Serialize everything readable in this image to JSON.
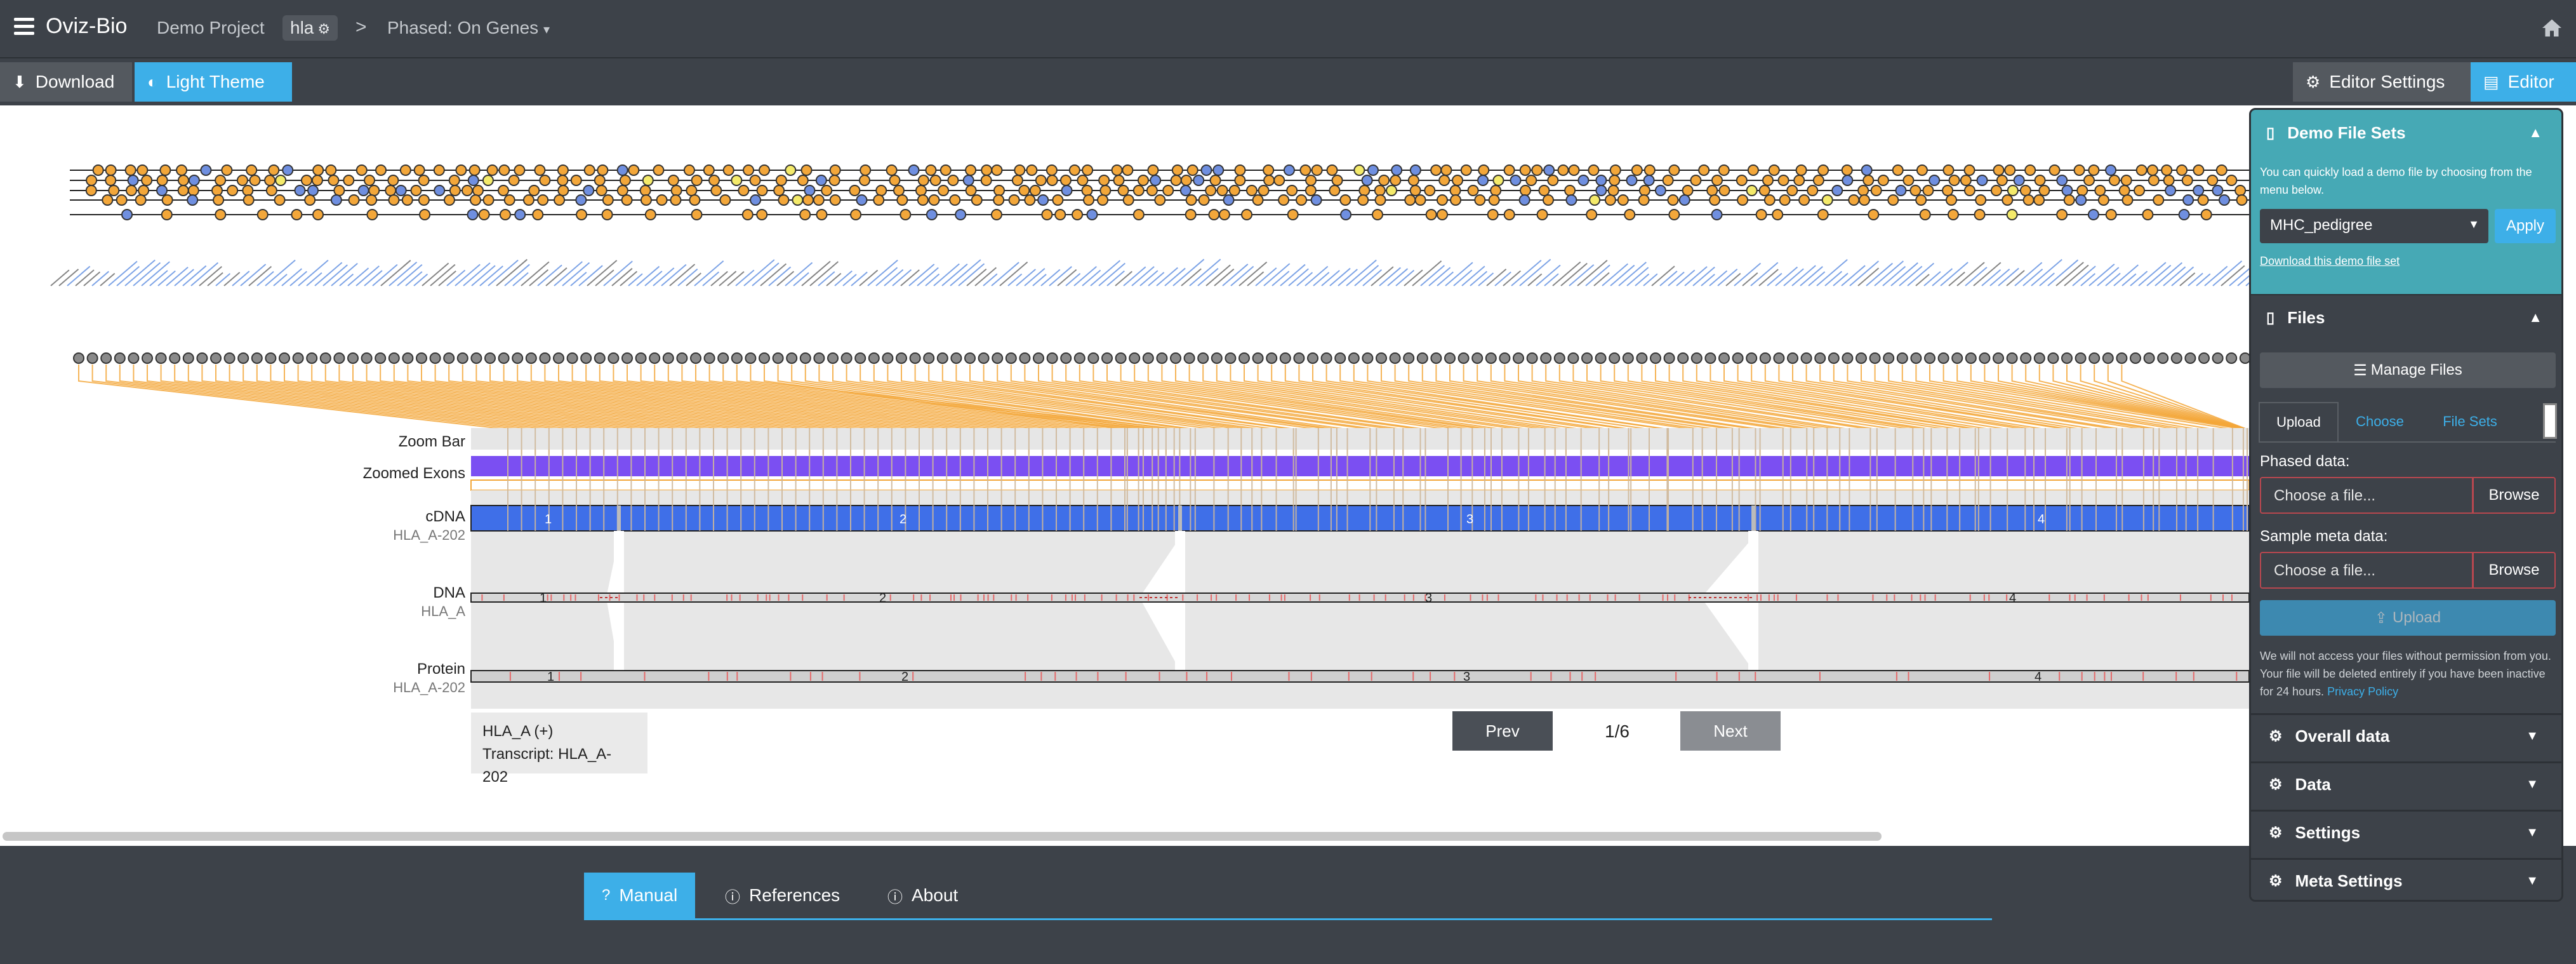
{
  "navbar": {
    "brand": "Oviz-Bio",
    "project": "Demo Project",
    "badge": "hla",
    "separator": ">",
    "phase": "Phased: On Genes",
    "icons": [
      "menu-icon",
      "gear-icon",
      "chevron-right-icon",
      "caret-down-icon",
      "home-icon"
    ]
  },
  "toolbar": {
    "download_label": "Download",
    "theme_label": "Light Theme",
    "editor_settings_label": "Editor Settings",
    "editor_label": "Editor"
  },
  "track_labels": {
    "zoom_bar": "Zoom Bar",
    "zoomed_exons": "Zoomed Exons",
    "cdna": "cDNA",
    "cdna_sub": "HLA_A-202",
    "dna": "DNA",
    "dna_sub": "HLA_A",
    "protein": "Protein",
    "protein_sub": "HLA_A-202"
  },
  "exon_numbers": [
    "1",
    "2",
    "3",
    "4"
  ],
  "info_box": {
    "gene": "HLA_A (+)",
    "transcript": "Transcript: HLA_A-202"
  },
  "pager": {
    "prev": "Prev",
    "count": "1/6",
    "next": "Next"
  },
  "bottom_tabs": {
    "manual": "Manual",
    "references": "References",
    "about": "About"
  },
  "editor_panel": {
    "demo": {
      "title": "Demo File Sets",
      "description": "You can quickly load a demo file by choosing from the menu below.",
      "selected": "MHC_pedigree",
      "apply": "Apply",
      "download_link": "Download this demo file set"
    },
    "files": {
      "title": "Files",
      "manage": "Manage Files",
      "tabs": [
        "Upload",
        "Choose",
        "File Sets"
      ],
      "phased_label": "Phased data:",
      "phased_placeholder": "Choose a file...",
      "meta_label": "Sample meta data:",
      "meta_placeholder": "Choose a file...",
      "browse": "Browse",
      "upload": "Upload",
      "privacy_text": "We will not access your files without permission from you. Your file will be deleted entirely if you have been inactive for 24 hours.",
      "privacy_link": "Privacy Policy"
    },
    "sections": [
      "Overall data",
      "Data",
      "Settings",
      "Meta Settings"
    ]
  },
  "colors": {
    "accent": "#3dafe8",
    "teal": "#46a9b5",
    "dark": "#3d4249",
    "orange_dot": "#f3a73a",
    "blue_dot": "#6f8fe0",
    "exon_blue": "#3f6fe8",
    "zoom_purple": "#7b4ff2",
    "variant_red": "#e46a6a"
  }
}
